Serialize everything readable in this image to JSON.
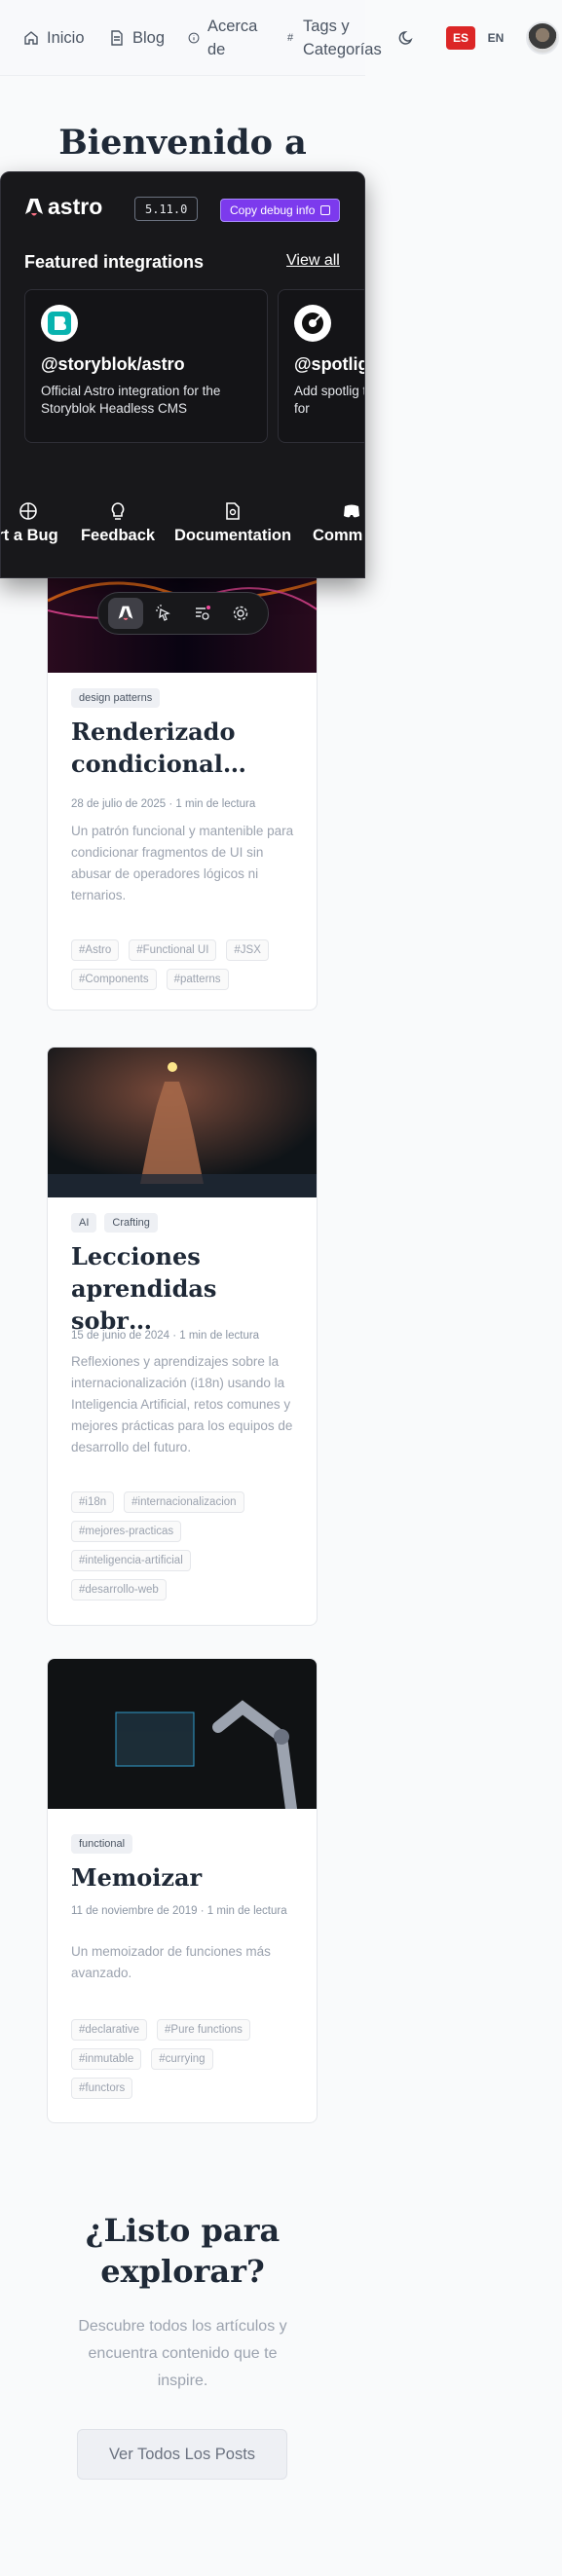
{
  "header": {
    "nav": [
      {
        "label": "Inicio",
        "icon": "home-icon"
      },
      {
        "label": "Blog",
        "icon": "document-icon"
      },
      {
        "label": "Acerca de",
        "icon": "info-icon"
      },
      {
        "label": "Tags y Categorías",
        "icon": "hash-icon"
      }
    ],
    "theme_icon": "moon-icon",
    "lang_es": "ES",
    "lang_en": "EN",
    "accent": "#dc2626"
  },
  "hero": {
    "title": "Bienvenido a"
  },
  "astro_toolbar": {
    "logo": "astro",
    "version": "5.11.0",
    "debug_button": "Copy debug info",
    "featured_title": "Featured integrations",
    "view_all": "View all",
    "integrations": [
      {
        "name": "@storyblok/astro",
        "desc": "Official Astro integration for the Storyblok Headless CMS"
      },
      {
        "name": "@spotlig",
        "desc": "Add spotlig toolbar, for"
      }
    ],
    "links": [
      "rt a Bug",
      "Feedback",
      "Documentation",
      "Comm"
    ]
  },
  "posts": [
    {
      "categories": [
        "design patterns"
      ],
      "title": "Renderizado condicional…",
      "meta": "28 de julio de 2025 · 1 min de lectura",
      "desc": "Un patrón funcional y mantenible para condicionar fragmentos de UI sin abusar de operadores lógicos ni ternarios.",
      "tags": [
        "#Astro",
        "#Functional UI",
        "#JSX",
        "#Components",
        "#patterns"
      ]
    },
    {
      "categories": [
        "AI",
        "Crafting"
      ],
      "title": "Lecciones aprendidas sobr…",
      "meta": "15 de junio de 2024 · 1 min de lectura",
      "desc": "Reflexiones y aprendizajes sobre la internacionalización (i18n) usando la Inteligencia Artificial, retos comunes y mejores prácticas para los equipos de desarrollo del futuro.",
      "tags": [
        "#i18n",
        "#internacionalizacion",
        "#mejores-practicas",
        "#inteligencia-artificial",
        "#desarrollo-web"
      ]
    },
    {
      "categories": [
        "functional"
      ],
      "title": "Memoizar",
      "meta": "11 de noviembre de 2019 · 1 min de lectura",
      "desc": "Un memoizador de funciones más avanzado.",
      "tags": [
        "#declarative",
        "#Pure functions",
        "#inmutable",
        "#currying",
        "#functors"
      ]
    }
  ],
  "cta": {
    "title": "¿Listo para explorar?",
    "text": "Descubre todos los artículos y encuentra contenido que te inspire.",
    "button": "Ver Todos Los Posts"
  }
}
